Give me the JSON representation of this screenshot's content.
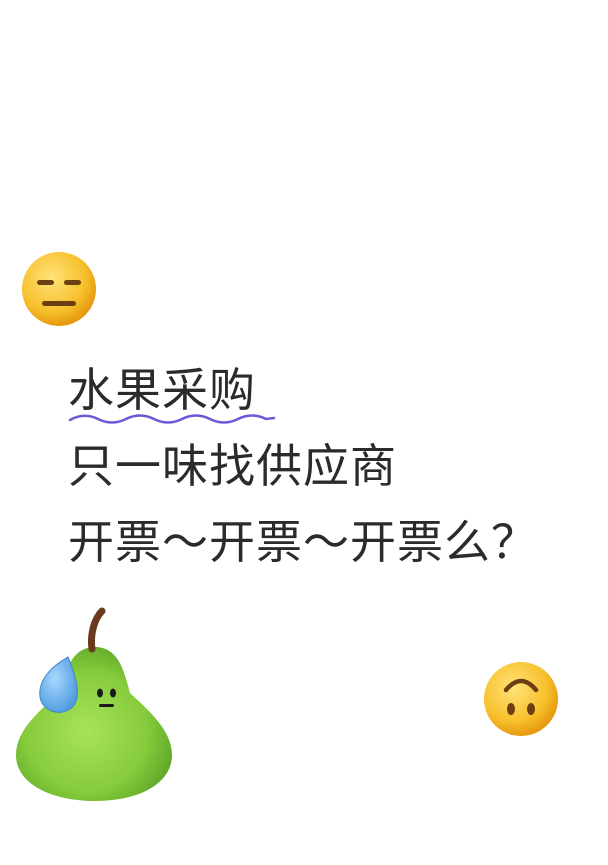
{
  "text": {
    "line1": "水果采购",
    "line2": "只一味找供应商",
    "line3": "开票～开票～开票么？"
  },
  "icons": {
    "top_emoji": "expressionless-face-emoji",
    "pear": "pear-character-sweat-drop",
    "bottom_emoji": "upside-down-face-emoji"
  },
  "colors": {
    "text": "#2b2b2b",
    "emoji_yellow": "#f7c02b",
    "pear_green": "#8fd346",
    "wavy_underline": "#6a5ad6"
  }
}
